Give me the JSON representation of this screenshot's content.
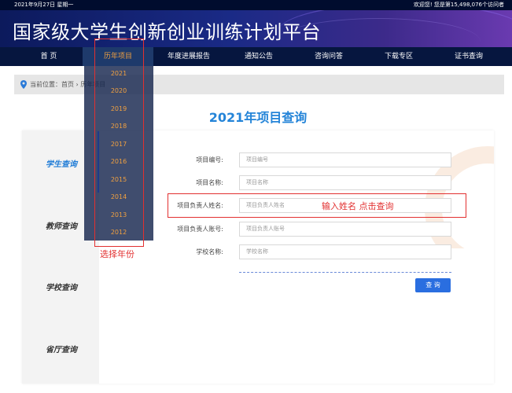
{
  "topbar": {
    "date": "2021年9月27日 星期一",
    "visits": "欢迎您! 您是第15,498,076个访问者"
  },
  "site_title": "国家级大学生创新创业训练计划平台",
  "nav": [
    {
      "label": "首 页"
    },
    {
      "label": "历年项目"
    },
    {
      "label": "年度进展报告"
    },
    {
      "label": "通知公告"
    },
    {
      "label": "咨询问答"
    },
    {
      "label": "下载专区"
    },
    {
      "label": "证书查询"
    }
  ],
  "breadcrumb": "当前位置：首页 › 历年项目",
  "years": [
    "2021",
    "2020",
    "2019",
    "2018",
    "2017",
    "2016",
    "2015",
    "2014",
    "2013",
    "2012"
  ],
  "page_title": "2021年项目查询",
  "side": [
    "学生查询",
    "教师查询",
    "学校查询",
    "省厅查询"
  ],
  "form": {
    "fields": [
      {
        "label": "项目编号:",
        "placeholder": "项目编号"
      },
      {
        "label": "项目名称:",
        "placeholder": "项目名称"
      },
      {
        "label": "项目负责人姓名:",
        "placeholder": "项目负责人姓名"
      },
      {
        "label": "项目负责人账号:",
        "placeholder": "项目负责人账号"
      },
      {
        "label": "学校名称:",
        "placeholder": "学校名称"
      }
    ],
    "submit": "查 询"
  },
  "annotations": {
    "year_hint": "选择年份",
    "name_hint": "输入姓名  点击查询"
  },
  "colors": {
    "accent": "#2484d8",
    "nav_bg": "#06163f",
    "highlight_orange": "#f0a040",
    "annotation_red": "#e23030",
    "button_blue": "#2a6ee0"
  }
}
